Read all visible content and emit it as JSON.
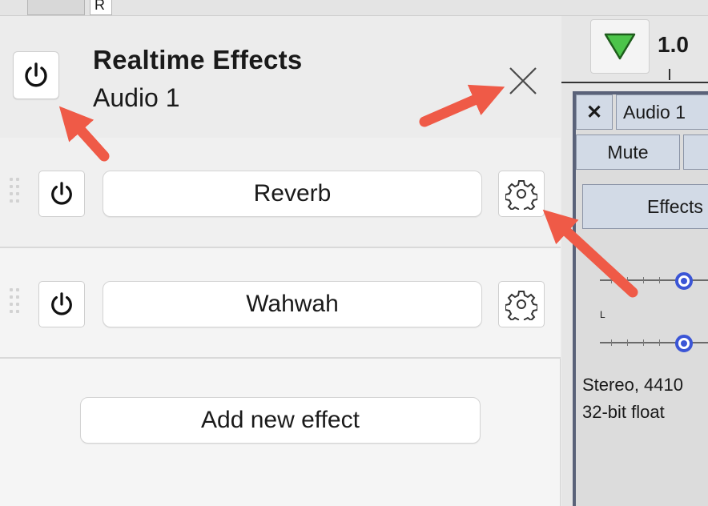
{
  "topbar": {
    "tab_label": "R"
  },
  "panel": {
    "title": "Realtime Effects",
    "subtitle": "Audio 1",
    "effects": [
      {
        "name": "Reverb"
      },
      {
        "name": "Wahwah"
      }
    ],
    "add_button_label": "Add new effect"
  },
  "track": {
    "scale_value": "1.0",
    "close_glyph": "✕",
    "name": "Audio 1",
    "mute_label": "Mute",
    "effects_label": "Effects",
    "pan_label": "L",
    "format_line1": "Stereo, 4410",
    "format_line2": "32-bit float"
  },
  "icons": {
    "power": "power-icon",
    "close": "close-icon",
    "gear": "gear-icon",
    "play": "play-triangle-icon",
    "grip": "drag-handle-icon",
    "annotation": "red-arrow"
  },
  "colors": {
    "arrow": "#ef5a47",
    "play_triangle": "#4cc44a",
    "slider_accent": "#3b55d6",
    "track_border": "#5a6279"
  }
}
